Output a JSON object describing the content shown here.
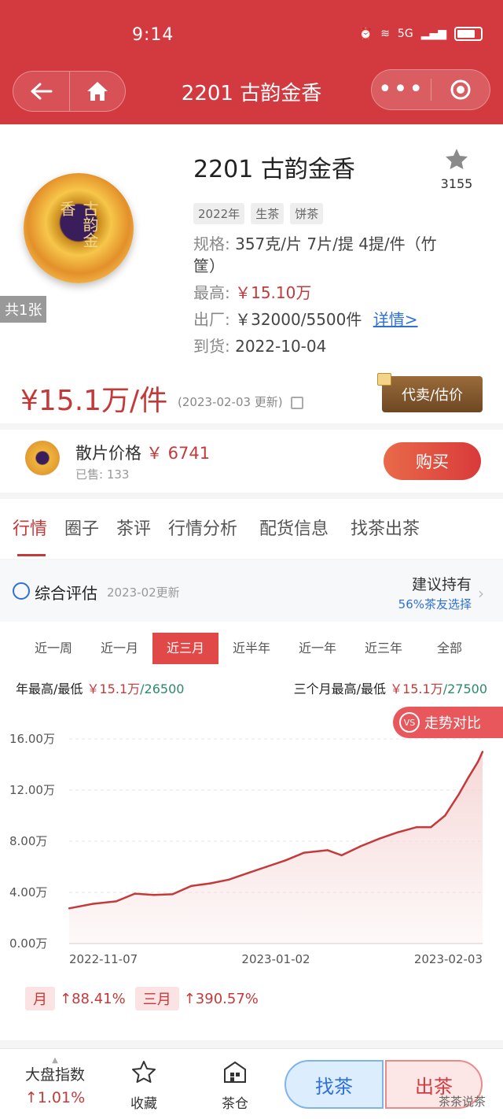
{
  "status": {
    "time": "9:14",
    "network": "5G"
  },
  "nav": {
    "title": "2201 古韵金香"
  },
  "product": {
    "image_count": "共1张",
    "cake_text": "古韵金香",
    "title": "2201 古韵金香",
    "fav_count": "3155",
    "tags": [
      "2022年",
      "生茶",
      "饼茶"
    ],
    "spec_label": "规格:",
    "spec_value": "357克/片 7片/提 4提/件（竹",
    "spec_value2": "筐）",
    "high_label": "最高:",
    "high_value": "￥15.10万",
    "factory_label": "出厂:",
    "factory_value": "￥32000/5500件",
    "detail_link": "详情>",
    "arrival_label": "到货:",
    "arrival_value": "2022-10-04",
    "price": "¥15.1万/件",
    "price_date": "(2023-02-03 更新)",
    "consign_label": "代卖/估价"
  },
  "loose": {
    "title": "散片价格",
    "price": "￥ 6741",
    "sold": "已售: 133",
    "buy_label": "购买"
  },
  "tabs": [
    "行情",
    "圈子",
    "茶评",
    "行情分析",
    "配货信息",
    "找茶出茶"
  ],
  "evaluation": {
    "title": "综合评估",
    "date": "2023-02更新",
    "suggestion": "建议持有",
    "pct": "56%茶友选择"
  },
  "ranges": [
    "近一周",
    "近一月",
    "近三月",
    "近半年",
    "近一年",
    "近三年",
    "全部"
  ],
  "active_range": "近三月",
  "extremes": {
    "year_label": "年最高/最低",
    "year_high": "￥15.1万",
    "year_low": "/26500",
    "three_label": "三个月最高/最低",
    "three_high": "￥15.1万",
    "three_low": "/27500"
  },
  "compare_label": "走势对比",
  "compare_icon": "VS",
  "chart_data": {
    "type": "area",
    "x_labels": [
      "2022-11-07",
      "2023-01-02",
      "2023-02-03"
    ],
    "y_ticks": [
      "0.00万",
      "4.00万",
      "8.00万",
      "12.00万",
      "16.00万"
    ],
    "ylim": [
      0,
      16
    ],
    "y_unit": "万",
    "x": [
      "2022-11-07",
      "2022-11-12",
      "2022-11-17",
      "2022-11-21",
      "2022-11-25",
      "2022-11-29",
      "2022-12-03",
      "2022-12-07",
      "2022-12-11",
      "2022-12-15",
      "2022-12-19",
      "2022-12-23",
      "2022-12-27",
      "2023-01-01",
      "2023-01-04",
      "2023-01-08",
      "2023-01-12",
      "2023-01-16",
      "2023-01-20",
      "2023-01-23",
      "2023-01-26",
      "2023-01-29",
      "2023-01-31",
      "2023-02-02",
      "2023-02-03"
    ],
    "values": [
      2.75,
      3.1,
      3.3,
      3.9,
      3.8,
      3.85,
      4.5,
      4.7,
      5.0,
      5.5,
      6.0,
      6.5,
      7.1,
      7.3,
      6.9,
      7.6,
      8.2,
      8.7,
      9.1,
      9.1,
      10.0,
      11.7,
      13.0,
      14.2,
      15.0
    ],
    "line_color": "#c43a3a",
    "fill_color": "#f6d6d6"
  },
  "changes": {
    "month_label": "月",
    "month_value": "↑88.41%",
    "three_label": "三月",
    "three_value": "↑390.57%"
  },
  "bottom": {
    "index_label": "大盘指数",
    "index_value": "↑1.01%",
    "fav_label": "收藏",
    "warehouse_label": "茶仓",
    "find_label": "找茶",
    "sell_label": "出茶",
    "watermark": "茶茶说茶"
  }
}
